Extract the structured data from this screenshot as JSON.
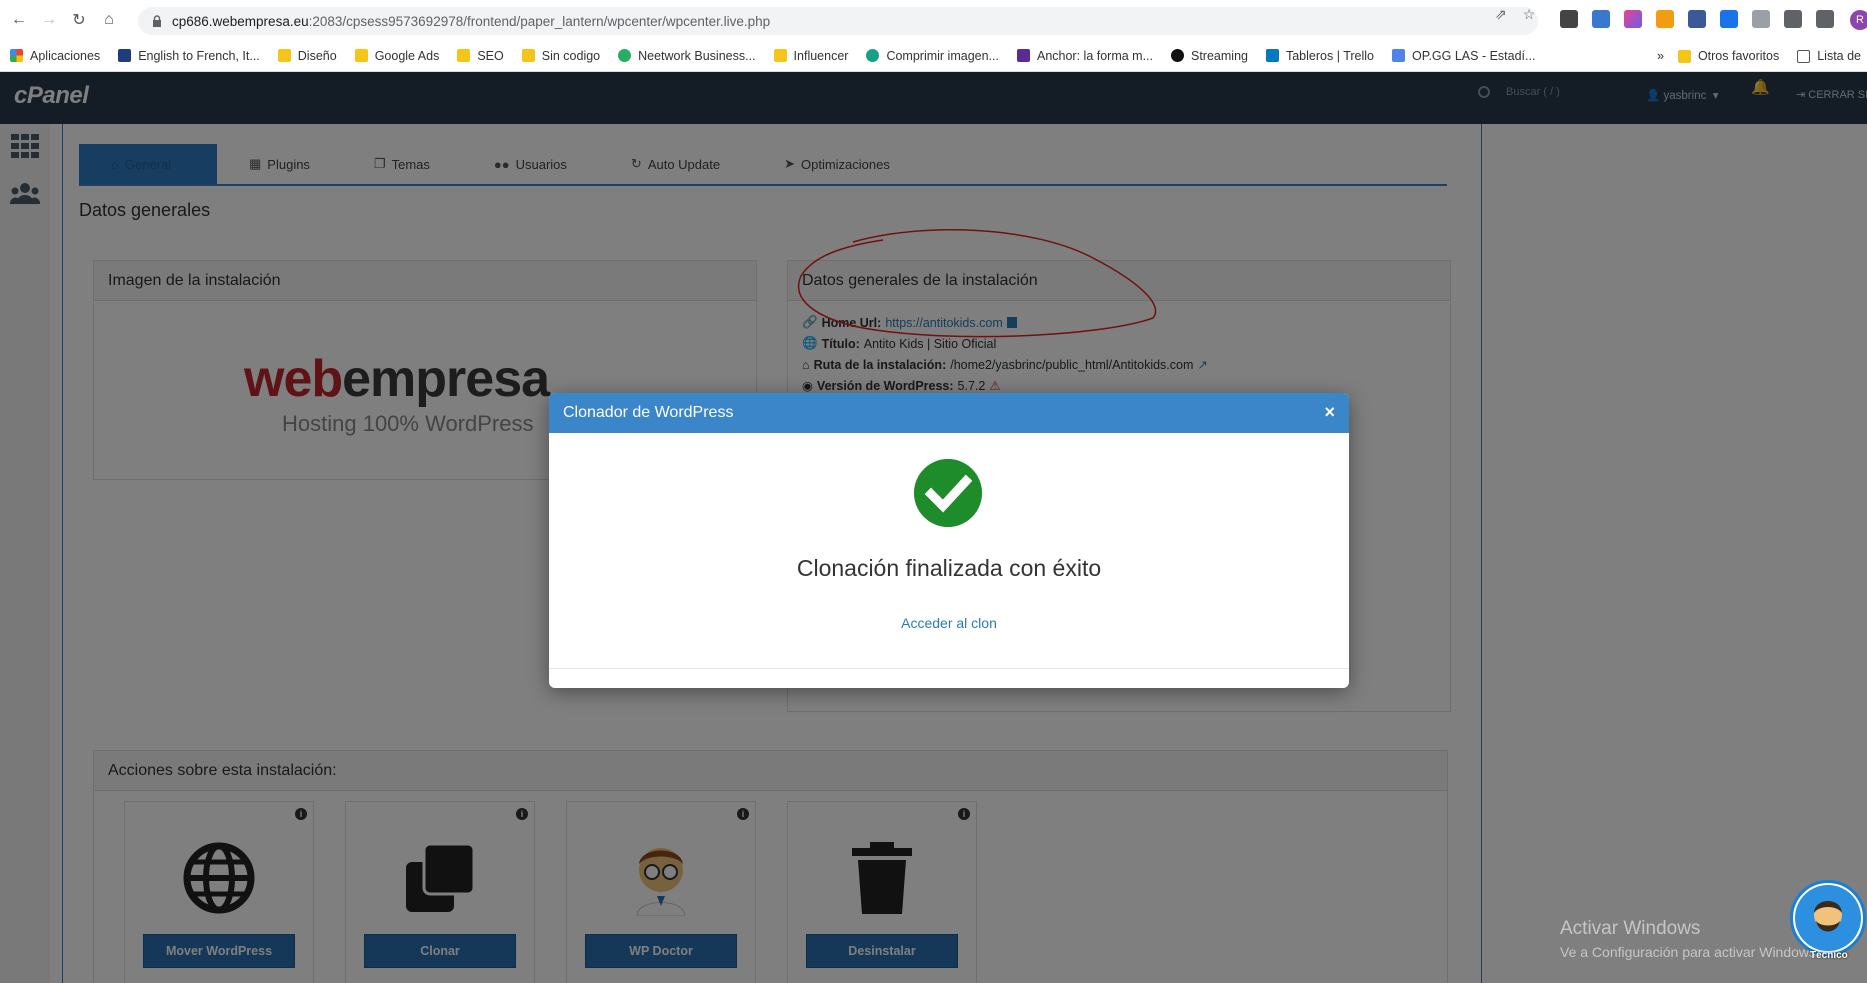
{
  "browser": {
    "url_host": "cp686.webempresa.eu",
    "url_path": ":2083/cpsess9573692978/frontend/paper_lantern/wpcenter/wpcenter.live.php",
    "profile_initial": "R",
    "bookmarks": [
      "Aplicaciones",
      "English to French, It...",
      "Diseño",
      "Google Ads",
      "SEO",
      "Sin codigo",
      "Neetwork Business...",
      "Influencer",
      "Comprimir imagen...",
      "Anchor: la forma m...",
      "Streaming",
      "Tableros | Trello",
      "OP.GG LAS - Estadí..."
    ],
    "bookmarks_more": "»",
    "bookmarks_other": "Otros favoritos",
    "reading_list": "Lista de"
  },
  "cpanel": {
    "logo": "cPanel",
    "search_placeholder": "Buscar ( / )",
    "user": "yasbrinc",
    "logout": "CERRAR SES"
  },
  "tabs": [
    {
      "label": "General"
    },
    {
      "label": "Plugins"
    },
    {
      "label": "Temas"
    },
    {
      "label": "Usuarios"
    },
    {
      "label": "Auto Update"
    },
    {
      "label": "Optimizaciones"
    }
  ],
  "section_title": "Datos generales",
  "image_panel": {
    "title": "Imagen de la instalación",
    "logo_red": "web",
    "logo_gray": "empresa",
    "logo_sub": "Hosting 100% WordPress"
  },
  "data_panel": {
    "title": "Datos generales de la instalación",
    "home_label": "Home Url:",
    "home_value": "https://antitokids.com",
    "title_label": "Título:",
    "title_value": "Antito Kids | Sitio Oficial",
    "path_label": "Ruta de la instalación:",
    "path_value": "/home2/yasbrinc/public_html/Antitokids.com",
    "version_label": "Versión de WordPress:",
    "version_value": "5.7.2"
  },
  "actions": {
    "title": "Acciones sobre esta instalación:",
    "buttons": [
      {
        "label": "Mover WordPress",
        "icon": "globe-icon"
      },
      {
        "label": "Clonar",
        "icon": "copy-icon"
      },
      {
        "label": "WP Doctor",
        "icon": "doctor-icon"
      },
      {
        "label": "Desinstalar",
        "icon": "trash-icon"
      }
    ]
  },
  "modal": {
    "title": "Clonador de WordPress",
    "close": "×",
    "message": "Clonación finalizada con éxito",
    "link": "Acceder al clon"
  },
  "watermark": {
    "line1": "Activar Windows",
    "line2": "Ve a Configuración para activar Windows."
  },
  "chat_widget": {
    "label": "Técnico"
  },
  "colors": {
    "cpanel_header": "#293a4a",
    "accent": "#3a86c8",
    "success": "#1e8c2a",
    "annotation": "#e02020"
  }
}
